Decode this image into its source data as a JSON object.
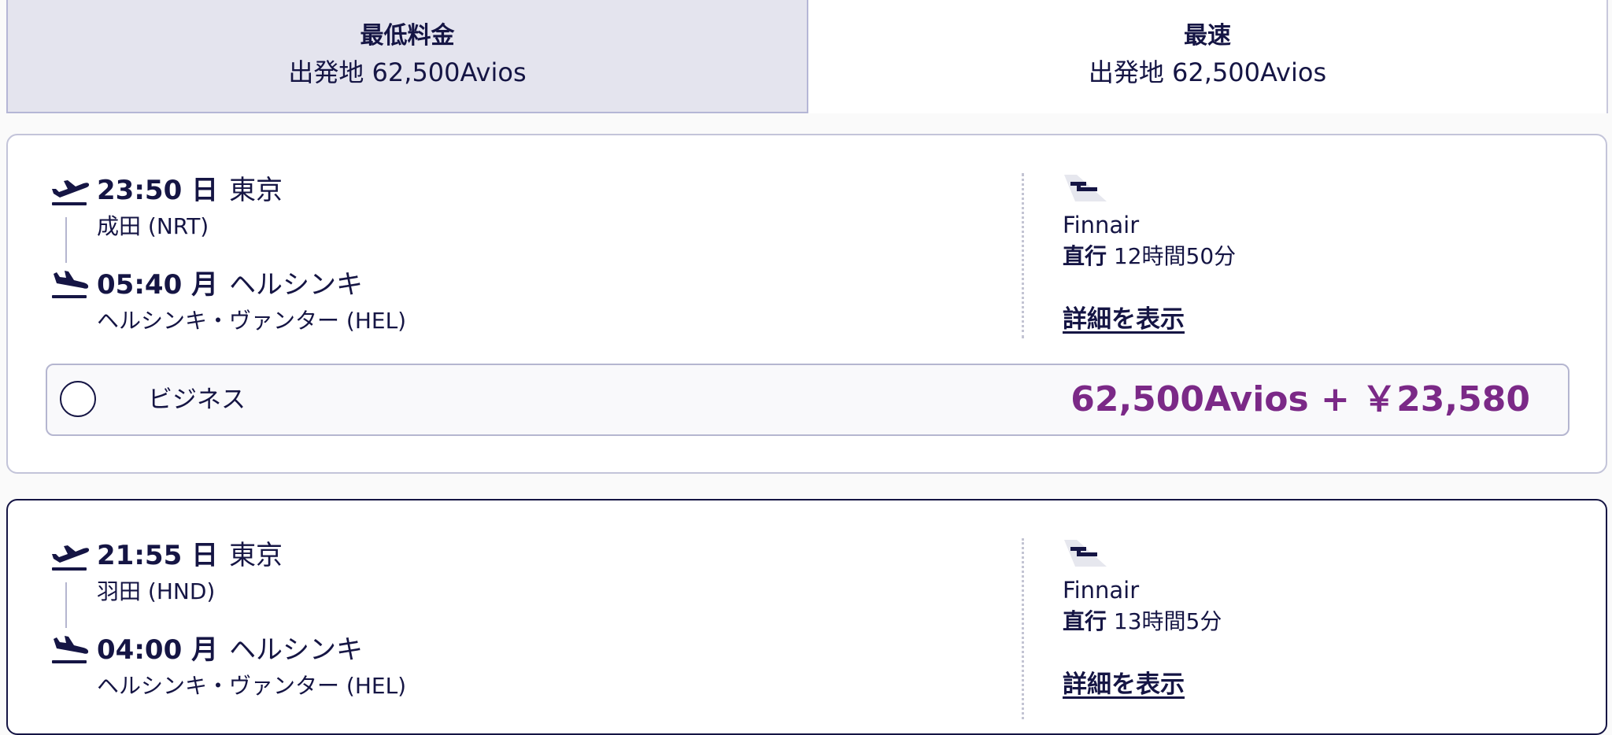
{
  "tabs": {
    "cheapest": {
      "title": "最低料金",
      "subtitle": "出発地 62,500Avios"
    },
    "fastest": {
      "title": "最速",
      "subtitle": "出発地 62,500Avios"
    }
  },
  "flights": [
    {
      "departure": {
        "time": "23:50 日",
        "city": "東京",
        "airport": "成田 (NRT)"
      },
      "arrival": {
        "time": "05:40 月",
        "city": "ヘルシンキ",
        "airport": "ヘルシンキ・ヴァンター (HEL)"
      },
      "airline": "Finnair",
      "stops": "直行",
      "duration": "12時間50分",
      "details_label": "詳細を表示",
      "fare": {
        "cabin": "ビジネス",
        "price": "62,500Avios + ￥23,580",
        "selected": false
      }
    },
    {
      "departure": {
        "time": "21:55 日",
        "city": "東京",
        "airport": "羽田 (HND)"
      },
      "arrival": {
        "time": "04:00 月",
        "city": "ヘルシンキ",
        "airport": "ヘルシンキ・ヴァンター (HEL)"
      },
      "airline": "Finnair",
      "stops": "直行",
      "duration": "13時間5分",
      "details_label": "詳細を表示"
    }
  ],
  "icons": {
    "takeoff": "plane-takeoff-icon",
    "landing": "plane-landing-icon",
    "airline_logo": "finnair-logo"
  },
  "colors": {
    "text": "#151544",
    "price": "#7b2987",
    "selected_tab_bg": "#e4e4ee",
    "border": "#c3c4d9"
  }
}
